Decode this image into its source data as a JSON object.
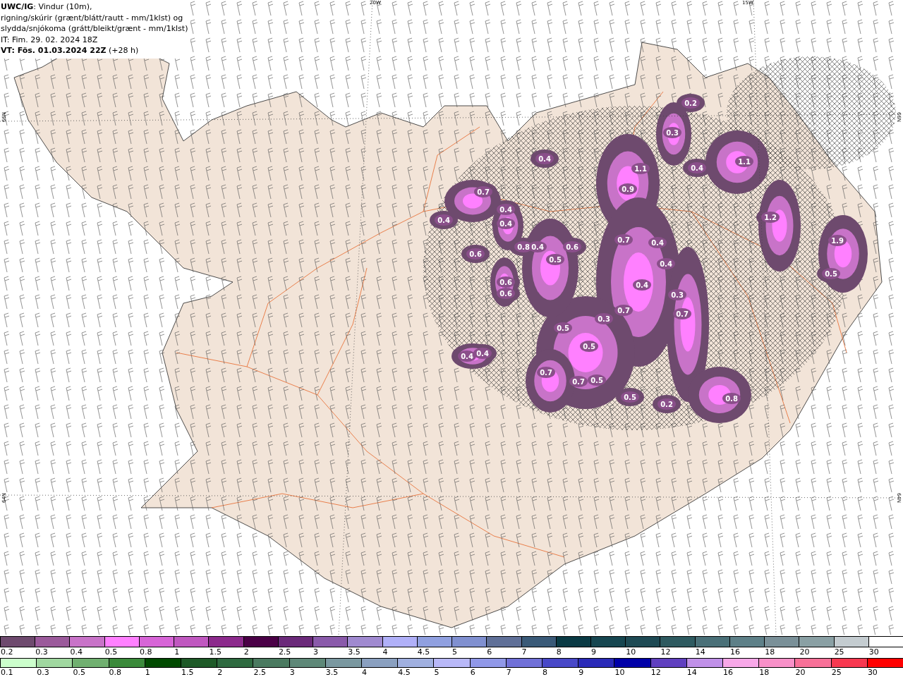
{
  "header": {
    "lines": [
      "**UWC/IG**: Vindur (10m),",
      "rigning/skúrir (grænt/blátt/rautt - mm/1klst) og",
      "slydda/snjókoma (grátt/bleikt/grænt - mm/1klst)",
      "IT: Fim. 29. 02. 2024 18Z",
      "**VT: Fös. 01.03.2024 22Z** (+28 h)"
    ]
  },
  "map": {
    "axis_labels": [
      {
        "text": "20W",
        "kind": "top"
      },
      {
        "text": "15W",
        "kind": "top"
      },
      {
        "text": "66N",
        "kind": "left"
      },
      {
        "text": "64N",
        "kind": "left"
      },
      {
        "text": "66N",
        "kind": "right"
      },
      {
        "text": "64N",
        "kind": "right"
      }
    ],
    "precip_labels": [
      "0.2",
      "0.3",
      "0.4",
      "1.1",
      "1.1",
      "0.9",
      "0.7",
      "0.4",
      "0.4",
      "0.4",
      "0.4",
      "0.6",
      "0.8",
      "0.4",
      "0.5",
      "0.6",
      "0.7",
      "0.4",
      "0.4",
      "1.2",
      "1.9",
      "0.5",
      "0.6",
      "0.6",
      "0.4",
      "0.3",
      "0.7",
      "0.3",
      "0.7",
      "0.5",
      "0.5",
      "0.4",
      "0.4",
      "0.7",
      "0.7",
      "0.5",
      "0.5",
      "0.2",
      "0.8"
    ]
  },
  "legend": {
    "rows": [
      {
        "kind": "snow",
        "items": [
          {
            "label": "0.2",
            "color": "#6e4a6e"
          },
          {
            "label": "0.3",
            "color": "#9b5a9b"
          },
          {
            "label": "0.4",
            "color": "#c873c8"
          },
          {
            "label": "0.5",
            "color": "#ff80ff"
          },
          {
            "label": "0.8",
            "color": "#d765d7"
          },
          {
            "label": "1",
            "color": "#c058c0"
          },
          {
            "label": "1.5",
            "color": "#8c2a8c"
          },
          {
            "label": "2",
            "color": "#4a0046"
          },
          {
            "label": "2.5",
            "color": "#6b2a7a"
          },
          {
            "label": "3",
            "color": "#8a5aaa"
          },
          {
            "label": "3.5",
            "color": "#a08ad0"
          },
          {
            "label": "4",
            "color": "#b0b0f8"
          },
          {
            "label": "4.5",
            "color": "#90a0e0"
          },
          {
            "label": "5",
            "color": "#8090d0"
          },
          {
            "label": "6",
            "color": "#607098"
          },
          {
            "label": "7",
            "color": "#3a5a78"
          },
          {
            "label": "8",
            "color": "#0a3a44"
          },
          {
            "label": "9",
            "color": "#164650"
          },
          {
            "label": "10",
            "color": "#1e4a54"
          },
          {
            "label": "12",
            "color": "#2e5a60"
          },
          {
            "label": "14",
            "color": "#4a7078"
          },
          {
            "label": "16",
            "color": "#5e8088"
          },
          {
            "label": "18",
            "color": "#7a9098"
          },
          {
            "label": "20",
            "color": "#8aa0a4"
          },
          {
            "label": "25",
            "color": "#c4ccd0"
          },
          {
            "label": "30",
            "color": "#ffffff"
          }
        ]
      },
      {
        "kind": "rain",
        "items": [
          {
            "label": "0.1",
            "color": "#ccffcc"
          },
          {
            "label": "0.3",
            "color": "#a0d8a0"
          },
          {
            "label": "0.5",
            "color": "#70b070"
          },
          {
            "label": "0.8",
            "color": "#3a8a3a"
          },
          {
            "label": "1",
            "color": "#004a00"
          },
          {
            "label": "1.5",
            "color": "#1e5a28"
          },
          {
            "label": "2",
            "color": "#2e6a40"
          },
          {
            "label": "2.5",
            "color": "#4a7a60"
          },
          {
            "label": "3",
            "color": "#5e8878"
          },
          {
            "label": "3.5",
            "color": "#7a98a0"
          },
          {
            "label": "4",
            "color": "#8aa0c0"
          },
          {
            "label": "4.5",
            "color": "#a0b0e0"
          },
          {
            "label": "5",
            "color": "#b8b8f8"
          },
          {
            "label": "6",
            "color": "#9098e8"
          },
          {
            "label": "7",
            "color": "#7070d8"
          },
          {
            "label": "8",
            "color": "#4848c8"
          },
          {
            "label": "9",
            "color": "#2a2ab8"
          },
          {
            "label": "10",
            "color": "#0000a8"
          },
          {
            "label": "12",
            "color": "#6040c0"
          },
          {
            "label": "14",
            "color": "#c090e8"
          },
          {
            "label": "16",
            "color": "#f8a8e8"
          },
          {
            "label": "18",
            "color": "#f890c8"
          },
          {
            "label": "20",
            "color": "#f87098"
          },
          {
            "label": "25",
            "color": "#f83850"
          },
          {
            "label": "30",
            "color": "#ff0000"
          }
        ]
      }
    ]
  }
}
